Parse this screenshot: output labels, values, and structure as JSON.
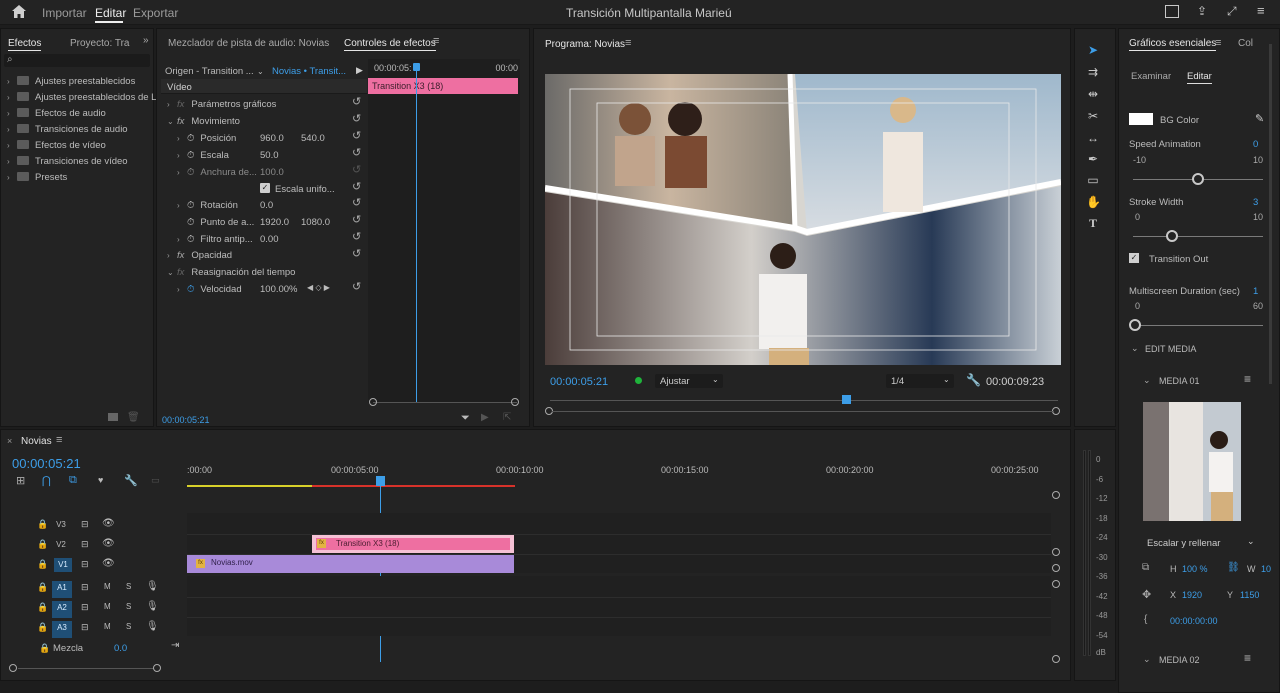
{
  "menu": {
    "home": "home-icon",
    "items": [
      "Importar",
      "Editar",
      "Exportar"
    ],
    "active": "Editar",
    "title": "Transición Multipantalla Marieú"
  },
  "effects_panel": {
    "tabs": [
      "Efectos",
      "Proyecto: Tra"
    ],
    "items": [
      "Ajustes preestablecidos",
      "Ajustes preestablecidos de Lu",
      "Efectos de audio",
      "Transiciones de audio",
      "Efectos de vídeo",
      "Transiciones de vídeo",
      "Presets"
    ]
  },
  "effect_controls": {
    "tabs": [
      "Mezclador de pista de audio: Novias",
      "Controles de efectos"
    ],
    "source": "Origen - Transition ...",
    "sequence": "Novias • Transit...",
    "section": "Vídeo",
    "time_start": "00:00:05:",
    "time_end": "00:00",
    "clip_label": "Transition X3 (18)",
    "rows": {
      "graphic_params": "Parámetros gráficos",
      "motion": "Movimiento",
      "position": "Posición",
      "position_x": "960.0",
      "position_y": "540.0",
      "scale": "Escala",
      "scale_val": "50.0",
      "width_scale": "Anchura de...",
      "width_val": "100.0",
      "uniform": "Escala unifo...",
      "rotation": "Rotación",
      "rotation_val": "0.0",
      "anchor": "Punto de a...",
      "anchor_x": "1920.0",
      "anchor_y": "1080.0",
      "antiflicker": "Filtro antip...",
      "antiflicker_val": "0.00",
      "opacity": "Opacidad",
      "time_remap": "Reasignación del tiempo",
      "speed": "Velocidad",
      "speed_val": "100.00%"
    },
    "timecode": "00:00:05:21"
  },
  "program": {
    "title": "Programa: Novias",
    "timecode": "00:00:05:21",
    "fit": "Ajustar",
    "resolution": "1/4",
    "duration": "00:00:09:23"
  },
  "essential_graphics": {
    "tabs": [
      "Gráficos esenciales",
      "Col"
    ],
    "subtabs": [
      "Examinar",
      "Editar"
    ],
    "bg_color_label": "BG Color",
    "speed_label": "Speed Animation",
    "speed_val": "0",
    "speed_min": "-10",
    "speed_max": "10",
    "speed_fraction": 0.5,
    "stroke_label": "Stroke Width",
    "stroke_val": "3",
    "stroke_min": "0",
    "stroke_max": "10",
    "stroke_fraction": 0.3,
    "transition_out": "Transition Out",
    "duration_label": "Multiscreen Duration (sec)",
    "duration_val": "1",
    "duration_min": "0",
    "duration_max": "60",
    "duration_fraction": 0.017,
    "edit_media": "EDIT MEDIA",
    "media1": "MEDIA 01",
    "fill_mode": "Escalar y rellenar",
    "h_label": "H",
    "h_val": "100 %",
    "w_label": "W",
    "w_val": "10",
    "x_label": "X",
    "x_val": "1920",
    "y_label": "Y",
    "y_val": "1150",
    "media_time": "00:00:00:00",
    "media2": "MEDIA 02",
    "colors": {
      "bg": "#ffffff",
      "accent": "#3d9ee8"
    }
  },
  "timeline": {
    "sequence": "Novias",
    "timecode": "00:00:05:21",
    "ruler": [
      ":00:00",
      "00:00:05:00",
      "00:00:10:00",
      "00:00:15:00",
      "00:00:20:00",
      "00:00:25:00"
    ],
    "tracks": [
      {
        "name": "V3"
      },
      {
        "name": "V2"
      },
      {
        "name": "V1"
      },
      {
        "name": "A1",
        "m": "M",
        "s": "S"
      },
      {
        "name": "A2",
        "m": "M",
        "s": "S"
      },
      {
        "name": "A3",
        "m": "M",
        "s": "S"
      }
    ],
    "clips": {
      "v2": "Transition X3 (18)",
      "v1": "Novias.mov"
    },
    "mix_label": "Mezcla",
    "mix_val": "0.0",
    "clip_colors": {
      "transition": "#ee6fa1",
      "video": "#a88ad9"
    }
  },
  "vu_meter": [
    "0",
    "-6",
    "-12",
    "-18",
    "-24",
    "-30",
    "-36",
    "-42",
    "-48",
    "-54",
    "dB"
  ]
}
